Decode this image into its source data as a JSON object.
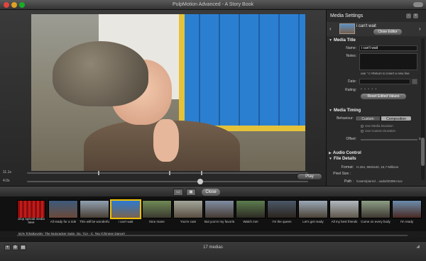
{
  "window": {
    "title": "PulpMotion Advanced - A Story Book"
  },
  "preview": {
    "timeline1_label": "11.1s",
    "timeline2_label": "4.0s",
    "play_label": "Play"
  },
  "panel": {
    "title": "Media Settings",
    "nav_label": "i can't wait",
    "close_editor_label": "Close Editor",
    "media_title": {
      "header": "Media Title",
      "name_label": "Name:",
      "name_value": "i can't wait",
      "notes_label": "Notes:",
      "hint": "use ⌥+Return to insert a new line",
      "date_label": "Date:",
      "rating_label": "Rating:",
      "rating_stars": "• • • • •",
      "reset_label": "Reset Edited Values"
    },
    "media_timing": {
      "header": "Media Timing",
      "behaviour_label": "Behaviour:",
      "option_custom": "Custom",
      "option_composition": "Composition",
      "radio_media": "Use Media Duration",
      "radio_custom": "Use Custom Duration",
      "offset_label": "Offset:",
      "offset_value": "0.("
    },
    "audio_control": {
      "header": "Audio Control"
    },
    "file_details": {
      "header": "File Details",
      "format_label": "Format:",
      "format_value": "H.264, 960x540, 16,7 Millions",
      "pixel_size_label": "Pixel Size :",
      "path_label": "Path :",
      "path_value": "/Users/pierre/…oads/00399.mov"
    }
  },
  "toolbar": {
    "close_label": "Close"
  },
  "filmstrip": {
    "curtain_text": "drop special media here",
    "clips": [
      {
        "label": "All ready for a ride",
        "c1": "#3d5a7a",
        "c2": "#6b4a3a"
      },
      {
        "label": "This will be wonderful",
        "c1": "#8fa0b0",
        "c2": "#4a3f35"
      },
      {
        "label": "i can't wait",
        "c1": "#2f7ad0",
        "c2": "#7a6350"
      },
      {
        "label": "Nice mane",
        "c1": "#6f8a55",
        "c2": "#3b3a30"
      },
      {
        "label": "You're cute",
        "c1": "#a2a59a",
        "c2": "#5a4e42"
      },
      {
        "label": "But you're my favorite",
        "c1": "#7f8ea3",
        "c2": "#463a33"
      },
      {
        "label": "Watch me!",
        "c1": "#5c7d4f",
        "c2": "#2e2a24"
      },
      {
        "label": "I'm the queen",
        "c1": "#4a5868",
        "c2": "#2c241d"
      },
      {
        "label": "Let's get ready",
        "c1": "#9aa8b6",
        "c2": "#4b4237"
      },
      {
        "label": "All my best friends",
        "c1": "#b0b8bf",
        "c2": "#5f574c"
      },
      {
        "label": "Come on every body",
        "c1": "#8c9e85",
        "c2": "#3e3831"
      },
      {
        "label": "I'm ready",
        "c1": "#6b8cad",
        "c2": "#4a2a22"
      }
    ]
  },
  "musicbar": {
    "text": "51%  Tchaikovsky: The Nutcracker Suite, Op. 71A - C. Tea (Chinese Dance)"
  },
  "status": {
    "media_count": "17 medias"
  }
}
